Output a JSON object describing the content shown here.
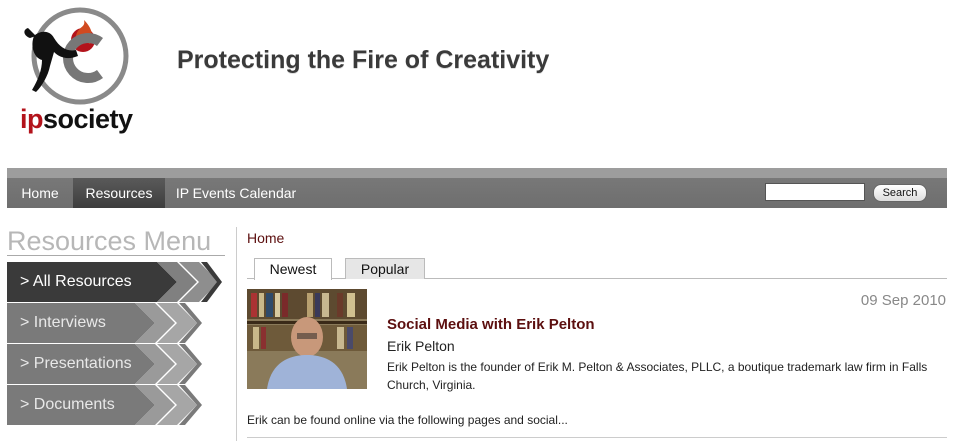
{
  "header": {
    "logo_text_ip": "ip",
    "logo_text_society": "society",
    "tagline": "Protecting the Fire of Creativity"
  },
  "nav": {
    "items": [
      {
        "label": "Home"
      },
      {
        "label": "Resources",
        "active": true
      },
      {
        "label": "IP Events Calendar"
      }
    ],
    "search_value": "",
    "search_button": "Search"
  },
  "sidebar": {
    "title": "Resources Menu",
    "items": [
      {
        "label": "> All Resources",
        "active": true
      },
      {
        "label": "> Interviews"
      },
      {
        "label": "> Presentations"
      },
      {
        "label": "> Documents"
      }
    ]
  },
  "content": {
    "breadcrumb": "Home",
    "tabs": [
      {
        "label": "Newest",
        "active": true
      },
      {
        "label": "Popular"
      }
    ],
    "post": {
      "date": "09 Sep 2010",
      "title": "Social Media with Erik Pelton",
      "author": "Erik Pelton",
      "description": "Erik Pelton is the founder of Erik M. Pelton & Associates, PLLC, a boutique trademark law firm in Falls Church, Virginia.",
      "excerpt": "Erik can be found online via the following pages and social..."
    }
  },
  "colors": {
    "accent": "#5c0f0f",
    "logo_red": "#b3131b",
    "nav_bg": "#6e6e6e",
    "menu_active": "#3a3a3a",
    "menu_inactive": "#777777"
  }
}
